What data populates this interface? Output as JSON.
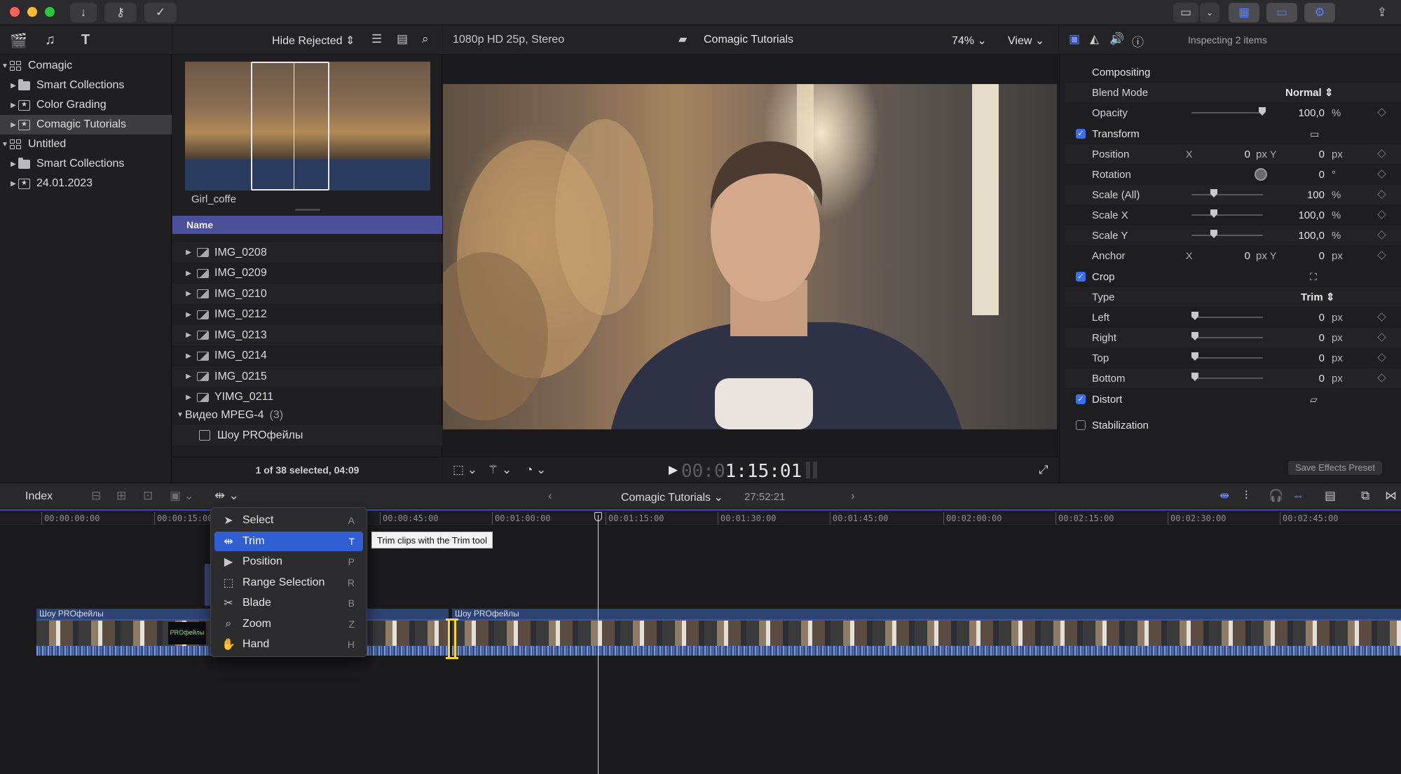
{
  "titlebar": {
    "traffic_colors": [
      "#fe5f57",
      "#febc2e",
      "#28c840"
    ],
    "buttons": [
      "download-icon",
      "key-icon",
      "checkmark-icon"
    ],
    "right_buttons": [
      "monitor-icon",
      "chevron-down-icon",
      "browser-layout-icon",
      "timeline-layout-icon",
      "inspector-layout-icon",
      "share-icon"
    ]
  },
  "library": {
    "icons": [
      "libraries-icon",
      "photos-music-icon",
      "titles-generators-icon"
    ],
    "items": [
      {
        "label": "Comagic",
        "type": "library",
        "expanded": true
      },
      {
        "label": "Smart Collections",
        "type": "folder"
      },
      {
        "label": "Color Grading",
        "type": "event"
      },
      {
        "label": "Comagic Tutorials",
        "type": "event",
        "selected": true
      },
      {
        "label": "Untitled",
        "type": "library",
        "expanded": true
      },
      {
        "label": "Smart Collections",
        "type": "folder"
      },
      {
        "label": "24.01.2023",
        "type": "event"
      }
    ]
  },
  "browser": {
    "filter_label": "Hide Rejected",
    "filmstrip_clip_name": "Girl_coffe",
    "column_header": "Name",
    "clips": [
      "IMG_0208",
      "IMG_0209",
      "IMG_0210",
      "IMG_0212",
      "IMG_0213",
      "IMG_0214",
      "IMG_0215",
      "YIMG_0211"
    ],
    "group": {
      "label": "Видео MPEG-4",
      "count": "(3)"
    },
    "group_items": [
      "Шоу PROфейлы"
    ],
    "status": "1 of 38 selected, 04:09"
  },
  "viewer": {
    "format": "1080p HD 25p, Stereo",
    "project": "Comagic Tutorials",
    "zoom": "74%",
    "view_label": "View",
    "timecode_dim": "00:0",
    "timecode": "1:15:01"
  },
  "inspector": {
    "header": "Inspecting 2 items",
    "tabs": [
      "video-inspector-icon",
      "color-inspector-icon",
      "audio-inspector-icon",
      "info-icon"
    ],
    "compositing": {
      "title": "Compositing",
      "blend_mode_label": "Blend Mode",
      "blend_mode_value": "Normal",
      "opacity_label": "Opacity",
      "opacity_value": "100,0",
      "opacity_unit": "%"
    },
    "transform": {
      "title": "Transform",
      "position_label": "Position",
      "position_x": "0",
      "position_y": "0",
      "rotation_label": "Rotation",
      "rotation_value": "0",
      "rotation_unit": "°",
      "scale_all_label": "Scale (All)",
      "scale_all_value": "100",
      "scale_x_label": "Scale X",
      "scale_x_value": "100,0",
      "scale_y_label": "Scale Y",
      "scale_y_value": "100,0",
      "anchor_label": "Anchor",
      "anchor_x": "0",
      "anchor_y": "0",
      "px": "px",
      "pct": "%",
      "x": "X",
      "y": "Y"
    },
    "crop": {
      "title": "Crop",
      "type_label": "Type",
      "type_value": "Trim",
      "left_label": "Left",
      "right_label": "Right",
      "top_label": "Top",
      "bottom_label": "Bottom",
      "value": "0"
    },
    "distort_title": "Distort",
    "stabilization_title": "Stabilization",
    "save_preset": "Save Effects Preset"
  },
  "timeline": {
    "index_label": "Index",
    "project": "Comagic Tutorials",
    "duration": "27:52:21",
    "ruler": [
      "00:00:00:00",
      "00:00:15:00",
      "00:00:45:00",
      "00:01:00:00",
      "00:01:15:00",
      "00:01:30:00",
      "00:01:45:00",
      "00:02:00:00",
      "00:02:15:00",
      "00:02:30:00",
      "00:02:45:00"
    ],
    "clip_names": [
      "Шоу PROфейлы",
      "Шоу PROфейлы"
    ],
    "overlay_text": "PROфейлы"
  },
  "tool_menu": {
    "items": [
      {
        "label": "Select",
        "key": "A",
        "icon": "arrow-pointer-icon"
      },
      {
        "label": "Trim",
        "key": "T",
        "icon": "trim-icon",
        "selected": true
      },
      {
        "label": "Position",
        "key": "P",
        "icon": "position-arrow-icon"
      },
      {
        "label": "Range Selection",
        "key": "R",
        "icon": "range-selection-icon"
      },
      {
        "label": "Blade",
        "key": "B",
        "icon": "scissors-icon"
      },
      {
        "label": "Zoom",
        "key": "Z",
        "icon": "magnifier-icon"
      },
      {
        "label": "Hand",
        "key": "H",
        "icon": "hand-icon"
      }
    ],
    "tooltip": "Trim clips with the Trim tool"
  }
}
